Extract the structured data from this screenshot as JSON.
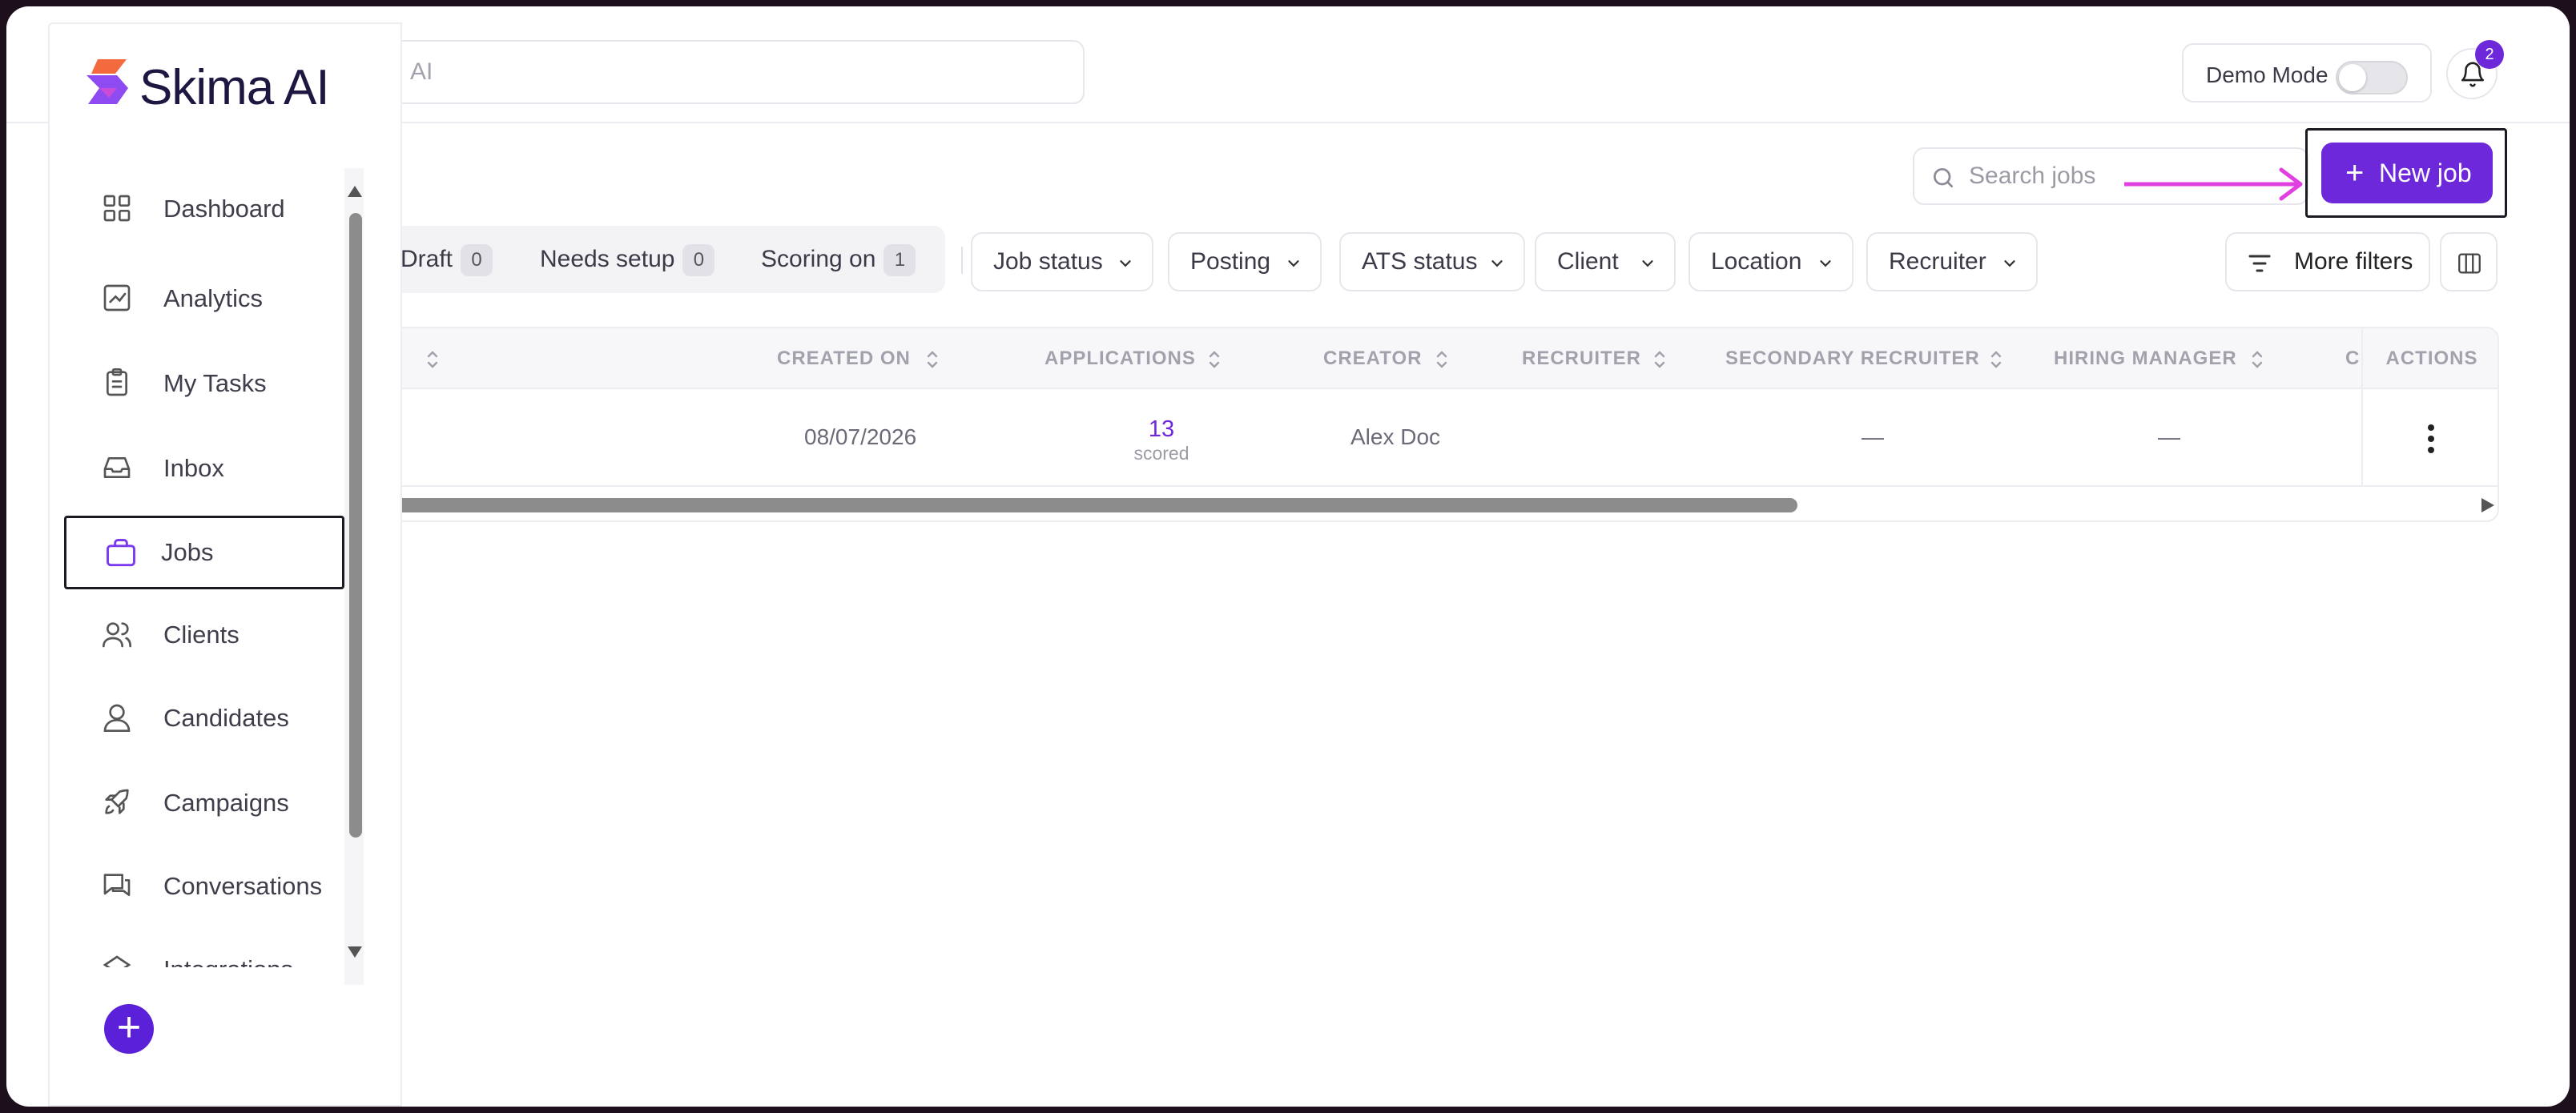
{
  "app": {
    "name": "Skima AI",
    "brand_color": "#6d28d9"
  },
  "header": {
    "global_search_text": "AI",
    "demo_mode_label": "Demo Mode",
    "demo_mode_on": false,
    "notification_count": "2"
  },
  "sidebar": {
    "items": [
      {
        "label": "Dashboard",
        "icon": "grid-icon"
      },
      {
        "label": "Analytics",
        "icon": "chart-line-icon"
      },
      {
        "label": "My Tasks",
        "icon": "clipboard-icon"
      },
      {
        "label": "Inbox",
        "icon": "inbox-icon"
      },
      {
        "label": "Jobs",
        "icon": "briefcase-icon",
        "active": true
      },
      {
        "label": "Clients",
        "icon": "users-icon"
      },
      {
        "label": "Candidates",
        "icon": "user-icon"
      },
      {
        "label": "Campaigns",
        "icon": "rocket-icon"
      },
      {
        "label": "Conversations",
        "icon": "chat-icon"
      },
      {
        "label": "Integrations",
        "icon": "integrations-icon"
      }
    ]
  },
  "toolbar": {
    "job_search_placeholder": "Search jobs",
    "new_job_label": "New job"
  },
  "status_tabs": [
    {
      "label": "Draft",
      "count": "0"
    },
    {
      "label": "Needs setup",
      "count": "0"
    },
    {
      "label": "Scoring on",
      "count": "1"
    }
  ],
  "filters": [
    "Job status",
    "Posting",
    "ATS status",
    "Client",
    "Location",
    "Recruiter"
  ],
  "more_filters_label": "More filters",
  "table": {
    "columns": [
      "CREATED ON",
      "APPLICATIONS",
      "CREATOR",
      "RECRUITER",
      "SECONDARY RECRUITER",
      "HIRING MANAGER",
      "C",
      "ACTIONS"
    ],
    "rows": [
      {
        "created_on": "08/07/2026",
        "applications": "13",
        "applications_sub": "scored",
        "creator": "Alex Doc",
        "recruiter": "",
        "secondary_recruiter": "—",
        "hiring_manager": "—"
      }
    ]
  }
}
